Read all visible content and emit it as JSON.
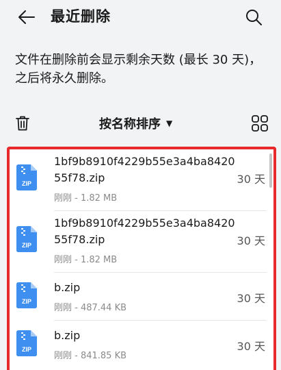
{
  "header": {
    "title": "最近删除",
    "back_icon": "arrow-left-icon",
    "search_icon": "search-icon"
  },
  "notice": "文件在删除前会显示剩余天数 (最长 30 天)，之后将永久删除。",
  "toolbar": {
    "sort_label": "按名称排序",
    "trash_icon": "trash-icon",
    "grid_icon": "grid-view-icon"
  },
  "files": [
    {
      "name": "1bf9b8910f4229b55e3a4ba842055f78.zip",
      "meta": "刚刚 - 1.82 MB",
      "days": "30 天",
      "icon_label": "ZIP"
    },
    {
      "name": "1bf9b8910f4229b55e3a4ba842055f78.zip",
      "meta": "刚刚 - 1.82 MB",
      "days": "30 天",
      "icon_label": "ZIP"
    },
    {
      "name": "b.zip",
      "meta": "刚刚 - 487.44 KB",
      "days": "30 天",
      "icon_label": "ZIP"
    },
    {
      "name": "b.zip",
      "meta": "刚刚 - 841.85 KB",
      "days": "30 天",
      "icon_label": "ZIP"
    }
  ],
  "colors": {
    "highlight_border": "#e8292b",
    "zip_icon": "#3f8ff0",
    "background": "#f1f3f5"
  }
}
